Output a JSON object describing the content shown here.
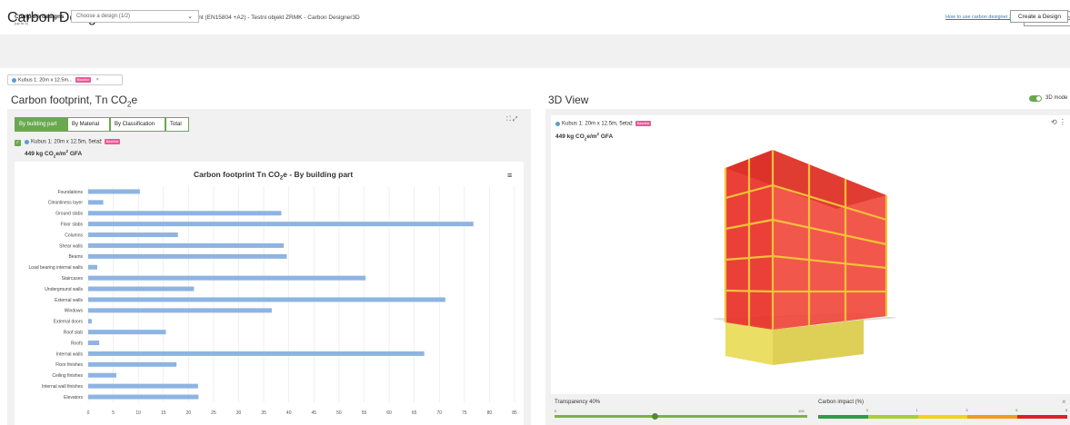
{
  "header": {
    "app_title": "Carbon Designer 3D",
    "subtitle": "Level(s) life-cycle assessment (EN15804 +A2) - Testni objekt ZRMK - Carbon Designer3D",
    "help_link": "How to use carbon designer 3D >",
    "return_button": "Return to project"
  },
  "compare": {
    "label": "Compare designs",
    "sublabel": "(up to 4)",
    "select_placeholder": "Choose a design (1/2)",
    "create_button": "Create a Design"
  },
  "chip": {
    "label": "Kubus 1: 20m x 12.5m...",
    "badge": "Baseline",
    "close": "×"
  },
  "carbon_footprint": {
    "title_main": "Carbon footprint, Tn CO",
    "title_sub": "2",
    "title_end": "e",
    "tabs": [
      "By building part",
      "By Material",
      "By Classification",
      "Total"
    ],
    "active_tab": 0,
    "legend_name": "Kubus 1: 20m x 12.5m, 5etaž",
    "legend_badge": "Baseline",
    "gfa_value": "449 kg CO",
    "gfa_sub": "2",
    "gfa_mid": "e/m",
    "gfa_sup": "2",
    "gfa_end": " GFA",
    "chart_title_main": "Carbon footprint Tn CO",
    "chart_title_sub": "2",
    "chart_title_end": "e - By building part",
    "menu_icon": "≡"
  },
  "chart_data": {
    "type": "bar",
    "orientation": "horizontal",
    "categories": [
      "Foundations",
      "Cleanliness layer",
      "Ground slabs",
      "Floor slabs",
      "Columns",
      "Shear walls",
      "Beams",
      "Load bearing internal walls",
      "Staircases",
      "Underground walls",
      "External walls",
      "Windows",
      "External doors",
      "Roof slab",
      "Roofs",
      "Internal walls",
      "Floor finishes",
      "Ceiling finishes",
      "Internal wall finishes",
      "Elevators"
    ],
    "values": [
      10.3,
      3.0,
      38.5,
      76.8,
      17.9,
      39.0,
      39.6,
      1.8,
      55.3,
      21.1,
      71.2,
      36.6,
      0.7,
      15.5,
      2.2,
      67.0,
      17.6,
      5.6,
      21.9,
      22.0
    ],
    "xlim": [
      0,
      85
    ],
    "xticks": [
      0,
      5,
      10,
      15,
      20,
      25,
      30,
      35,
      40,
      45,
      50,
      55,
      60,
      65,
      70,
      75,
      80,
      85
    ],
    "color": "#8db4e2",
    "grid": true,
    "title": "Carbon footprint Tn CO2e - By building part"
  },
  "view3d": {
    "title": "3D View",
    "toggle_label": "3D mode",
    "legend_name": "Kubus 1: 20m x 12.5m, 5etaž",
    "legend_badge": "Baseline",
    "gfa_value": "449 kg CO",
    "gfa_sub": "2",
    "gfa_mid": "e/m",
    "gfa_sup": "2",
    "gfa_end": " GFA",
    "tools": "⟲ ⋮"
  },
  "transparency": {
    "label": "Transparency 40%",
    "min": "0",
    "max": "100",
    "value": 40
  },
  "carbon_impact": {
    "label": "Carbon impact (%)",
    "ticks": [
      "0",
      "1",
      "3",
      "5",
      "8"
    ],
    "close": "×",
    "colors": [
      "#2e9e44",
      "#a6cf38",
      "#f2d21b",
      "#f29a1f",
      "#e02020"
    ]
  },
  "icons": {
    "left_tools": "chart-tools-icon",
    "check": "checkbox-checked-icon"
  }
}
